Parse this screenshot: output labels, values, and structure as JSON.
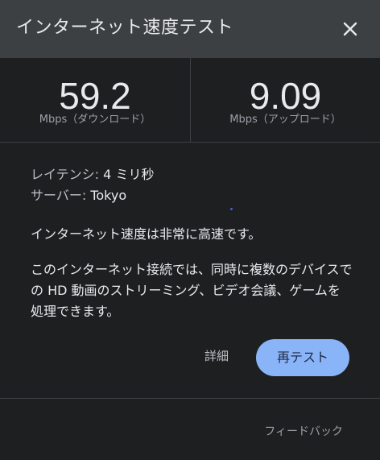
{
  "header": {
    "title": "インターネット速度テスト",
    "close_icon": "close-icon"
  },
  "download": {
    "value": "59.2",
    "unit_label": "Mbps（ダウンロード）"
  },
  "upload": {
    "value": "9.09",
    "unit_label": "Mbps（アップロード）"
  },
  "latency": {
    "label": "レイテンシ:",
    "value": "4 ミリ秒"
  },
  "server": {
    "label": "サーバー:",
    "value": "Tokyo"
  },
  "summary": "インターネット速度は非常に高速です。",
  "description": "このインターネット接続では、同時に複数のデバイスでの HD 動画のストリーミング、ビデオ会議、ゲームを処理できます。",
  "actions": {
    "details_label": "詳細",
    "retest_label": "再テスト"
  },
  "footer": {
    "feedback_label": "フィードバック"
  },
  "colors": {
    "background": "#1e1f21",
    "header_bg": "#3c4043",
    "accent": "#8ab4f8"
  }
}
